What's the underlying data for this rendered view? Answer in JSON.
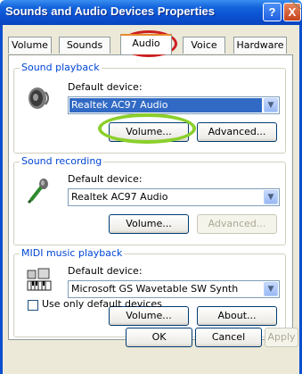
{
  "window": {
    "title": "Sounds and Audio Devices Properties",
    "help_glyph": "?",
    "close_glyph": "X"
  },
  "tabs": [
    {
      "label": "Volume",
      "selected": false
    },
    {
      "label": "Sounds",
      "selected": false
    },
    {
      "label": "Audio",
      "selected": true
    },
    {
      "label": "Voice",
      "selected": false
    },
    {
      "label": "Hardware",
      "selected": false
    }
  ],
  "playback": {
    "group_label": "Sound playback",
    "icon": "speaker-icon",
    "default_device_label": "Default device:",
    "device_value": "Realtek AC97 Audio",
    "volume_button": "Volume...",
    "advanced_button": "Advanced..."
  },
  "recording": {
    "group_label": "Sound recording",
    "icon": "microphone-icon",
    "default_device_label": "Default device:",
    "device_value": "Realtek AC97 Audio",
    "volume_button": "Volume...",
    "advanced_button": "Advanced..."
  },
  "midi": {
    "group_label": "MIDI music playback",
    "icon": "keyboard-icon",
    "default_device_label": "Default device:",
    "device_value": "Microsoft GS Wavetable SW Synth",
    "volume_button": "Volume...",
    "about_button": "About..."
  },
  "use_default_only": {
    "label": "Use only default devices",
    "checked": false
  },
  "footer": {
    "ok": "OK",
    "cancel": "Cancel",
    "apply": "Apply"
  },
  "colors": {
    "titlebar": "#0a4fd0",
    "group_label": "#0046d5",
    "selected_item": "#316ac5",
    "annotation_red": "#cc1f1f",
    "annotation_green": "#8ccf2c"
  }
}
